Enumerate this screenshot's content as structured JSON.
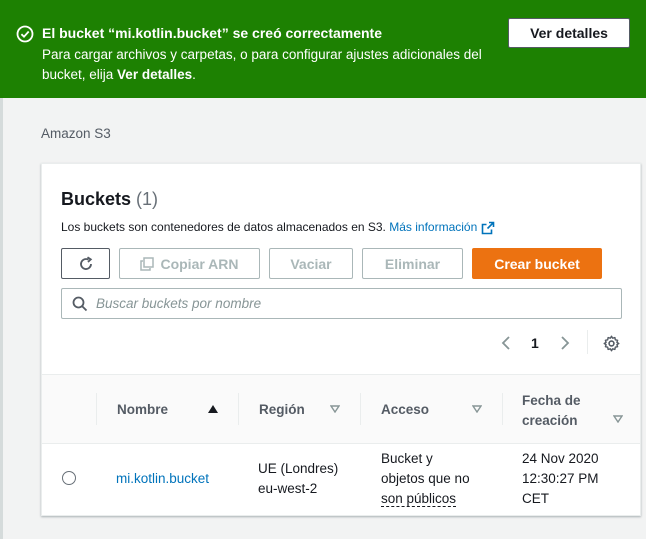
{
  "banner": {
    "title": "El bucket “mi.kotlin.bucket” se creó correctamente",
    "desc_prefix": "Para cargar archivos y carpetas, o para configurar ajustes adicionales del bucket, elija ",
    "desc_bold": "Ver detalles",
    "desc_suffix": ".",
    "button": "Ver detalles"
  },
  "breadcrumb": "Amazon S3",
  "card": {
    "title": "Buckets",
    "count": "(1)",
    "description": "Los buckets son contenedores de datos almacenados en S3.",
    "learn_more": "Más información"
  },
  "toolbar": {
    "copy_arn": "Copiar ARN",
    "empty": "Vaciar",
    "delete": "Eliminar",
    "create": "Crear bucket"
  },
  "search": {
    "placeholder": "Buscar buckets por nombre",
    "value": ""
  },
  "pagination": {
    "current_page": "1"
  },
  "table": {
    "columns": {
      "name": "Nombre",
      "region": "Región",
      "access": "Acceso",
      "created_line1": "Fecha de",
      "created_line2": "creación"
    },
    "rows": [
      {
        "name": "mi.kotlin.bucket",
        "region_line1": "UE (Londres)",
        "region_line2": "eu-west-2",
        "access_line1": "Bucket y",
        "access_line2": "objetos que no",
        "access_line3": "son públicos",
        "created_line1": "24 Nov 2020",
        "created_line2": "12:30:27 PM",
        "created_line3": "CET"
      }
    ]
  },
  "colors": {
    "success": "#1d8102",
    "primary": "#ec7211",
    "link": "#0073bb",
    "text": "#16191f",
    "muted": "#687078"
  },
  "icons": [
    "success-check-icon",
    "external-link-icon",
    "refresh-icon",
    "copy-icon",
    "search-icon",
    "chevron-left-icon",
    "chevron-right-icon",
    "settings-gear-icon",
    "sort-ascending-icon",
    "sort-descending-icon"
  ]
}
